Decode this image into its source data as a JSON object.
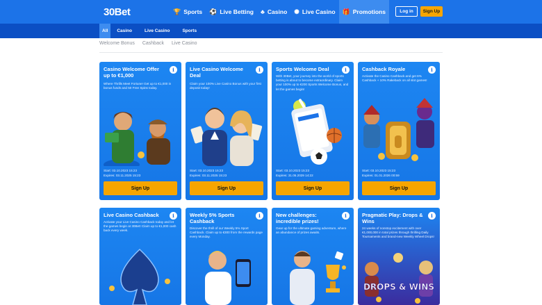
{
  "header": {
    "logo": "30Bet",
    "nav": [
      {
        "label": "Sports",
        "icon": "trophy-icon"
      },
      {
        "label": "Live Betting",
        "icon": "live-betting-icon"
      },
      {
        "label": "Casino",
        "icon": "casino-icon"
      },
      {
        "label": "Live Casino",
        "icon": "live-casino-icon"
      },
      {
        "label": "Promotions",
        "icon": "gift-icon"
      }
    ],
    "login": "Log in",
    "signup": "Sign Up"
  },
  "subnav": [
    "All",
    "Casino",
    "Live Casino",
    "Sports"
  ],
  "tabs": [
    "Welcome Bonus",
    "Cashback",
    "Live Casino"
  ],
  "cards": [
    {
      "title": "Casino Welcome Offer up to €1,000",
      "desc": "Where Thrills Meet Fortune! Get up to €1,000 in bonus funds and 50 Free Spins today.",
      "start": "Start: 03.10.2023 15:23",
      "expires": "Expires: 03.11.2025 15:23",
      "button": "Sign Up"
    },
    {
      "title": "Live Casino Welcome Deal",
      "desc": "Claim your 100% Live Casino Bonus with your first deposit today!",
      "start": "Start: 03.10.2023 15:23",
      "expires": "Expires: 03.11.2025 15:23",
      "button": "Sign Up"
    },
    {
      "title": "Sports Welcome Deal",
      "desc": "With 30Bet, your journey into the world of sports betting is about to become extraordinary. Claim your 100% up to €200 Sports Welcome Bonus, and let the games begin!",
      "start": "Start: 03.10.2023 15:23",
      "expires": "Expires: 31.05.2029 14:22",
      "button": "Sign Up"
    },
    {
      "title": "Cashback Royale",
      "desc": "Activate the Casino Cashback and get 6% Cashback + 10% Rakeback on all slot games!",
      "start": "Start: 03.10.2023 15:23",
      "expires": "Expires: 01.01.2026 00:59",
      "button": "Sign Up"
    },
    {
      "title": "Live Casino Cashback",
      "desc": "Activate your Live Casino Cashback today and let the games begin at 30Bet! Claim up to €1,000 cash back every week."
    },
    {
      "title": "Weekly 5% Sports Cashback",
      "desc": "Discover the thrill of our Weekly 5% Sport Cashback. Claim up to €300 from the rewards page every Monday."
    },
    {
      "title": "New challenges: incredible prizes!",
      "desc": "Gear up for the ultimate gaming adventure, where an abundance of prizes awaits."
    },
    {
      "title": "Pragmatic Play: Drops & Wins",
      "desc": "24 weeks of nonstop excitement with over €1,000,000 in total prizes through thrilling Daily Tournaments and brand-new Weekly Wheel Drops!",
      "art_text": "DROPS & WINS"
    }
  ],
  "colors": {
    "brand": "#1c73e8",
    "subnav": "#0b4fc4",
    "accent": "#f6a500",
    "card": "#1d86f2"
  }
}
